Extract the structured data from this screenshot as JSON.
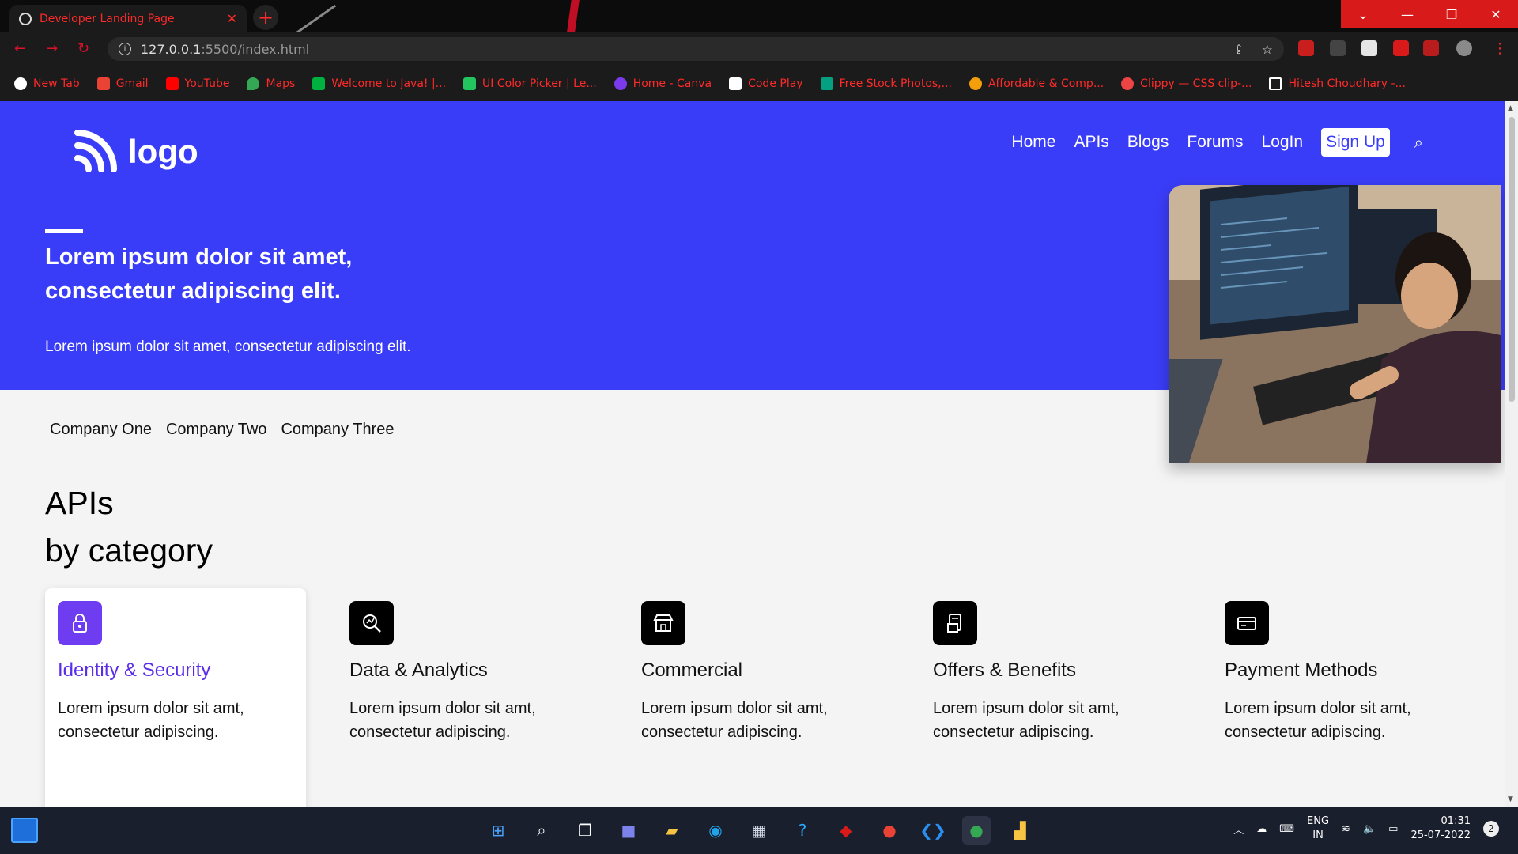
{
  "browser": {
    "tab_title": "Developer Landing Page",
    "tab_close": "✕",
    "new_tab": "+",
    "url_host": "127.0.0.1",
    "url_rest": ":5500/index.html",
    "window_controls": [
      "⌄",
      "—",
      "❐",
      "✕"
    ],
    "bookmarks": [
      {
        "label": "New Tab",
        "color": "#ffffff"
      },
      {
        "label": "Gmail",
        "color": "#ea4335"
      },
      {
        "label": "YouTube",
        "color": "#ff0000"
      },
      {
        "label": "Maps",
        "color": "#34a853"
      },
      {
        "label": "Welcome to Java! |...",
        "color": "#00b140"
      },
      {
        "label": "UI Color Picker | Le...",
        "color": "#22c55e"
      },
      {
        "label": "Home - Canva",
        "color": "#7c3aed"
      },
      {
        "label": "Code Play",
        "color": "#ffffff"
      },
      {
        "label": "Free Stock Photos,...",
        "color": "#05a081"
      },
      {
        "label": "Affordable & Comp...",
        "color": "#f59e0b"
      },
      {
        "label": "Clippy — CSS clip-...",
        "color": "#ef4444"
      },
      {
        "label": "Hitesh Choudhary -...",
        "color": "#ffffff"
      }
    ]
  },
  "site": {
    "logo_text": "logo",
    "nav": {
      "home": "Home",
      "apis": "APIs",
      "blogs": "Blogs",
      "forums": "Forums",
      "login": "LogIn",
      "signup": "Sign Up"
    },
    "hero": {
      "headline": "Lorem ipsum dolor sit amet, consectetur adipiscing elit.",
      "subtext": "Lorem ipsum dolor sit amet, consectetur adipiscing elit."
    },
    "companies": [
      "Company One",
      "Company Two",
      "Company Three"
    ],
    "apis_title_line1": "APIs",
    "apis_title_line2": "by category",
    "categories": [
      {
        "title": "Identity & Security",
        "desc": "Lorem ipsum dolor sit amt, consectetur adipiscing.",
        "icon": "lock-icon"
      },
      {
        "title": "Data & Analytics",
        "desc": "Lorem ipsum dolor sit amt, consectetur adipiscing.",
        "icon": "search-chart-icon"
      },
      {
        "title": "Commercial",
        "desc": "Lorem ipsum dolor sit amt, consectetur adipiscing.",
        "icon": "store-icon"
      },
      {
        "title": "Offers & Benefits",
        "desc": "Lorem ipsum dolor sit amt, consectetur adipiscing.",
        "icon": "document-icon"
      },
      {
        "title": "Payment Methods",
        "desc": "Lorem ipsum dolor sit amt, consectetur adipiscing.",
        "icon": "credit-card-icon"
      }
    ],
    "colors": {
      "primary": "#3a3df7",
      "accent": "#5a2de8",
      "background": "#f4f4f4"
    }
  },
  "taskbar": {
    "lang_line1": "ENG",
    "lang_line2": "IN",
    "time": "01:31",
    "date": "25-07-2022",
    "notifications": "2"
  }
}
